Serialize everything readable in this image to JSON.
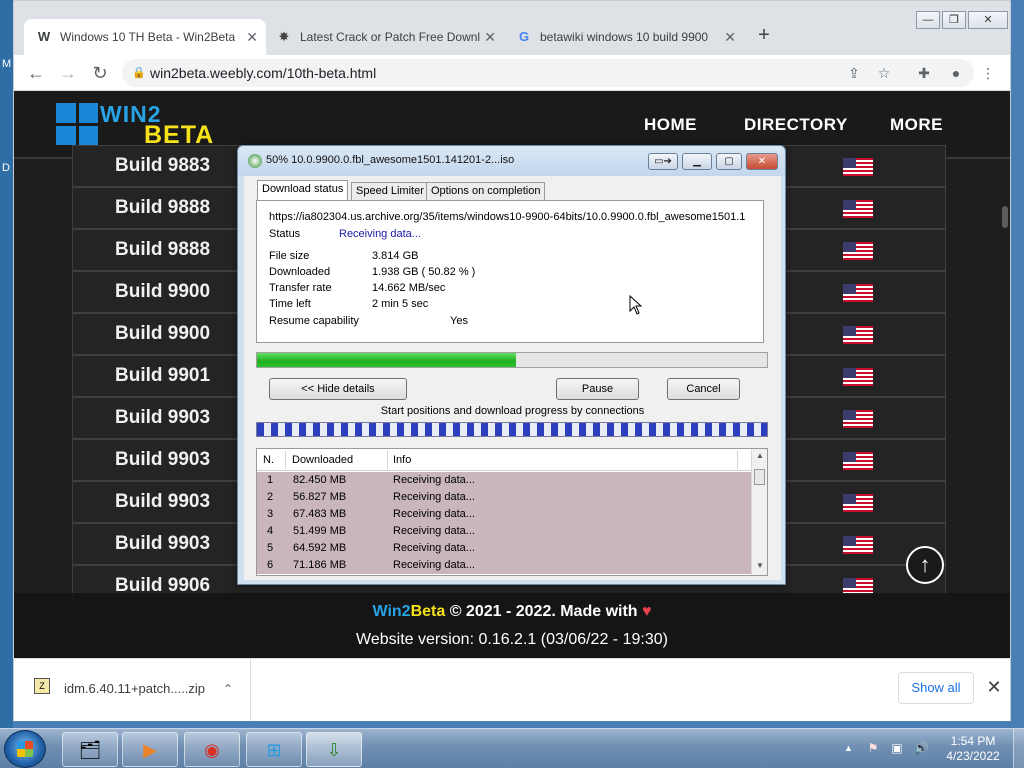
{
  "desktop": {
    "edge_labels": [
      "M",
      "D"
    ]
  },
  "browser": {
    "tabs": [
      {
        "title": "Windows 10 TH Beta - Win2Beta",
        "icon": "weebly-w-icon",
        "glyph": "W",
        "active": true
      },
      {
        "title": "Latest Crack or Patch Free Downl",
        "icon": "crack-site-icon",
        "glyph": "✸",
        "active": false
      },
      {
        "title": "betawiki windows 10 build 9900",
        "icon": "google-icon",
        "glyph": "G",
        "active": false
      }
    ],
    "new_tab": "+",
    "window_buttons": {
      "minimize": "—",
      "maximize": "❐",
      "close": "✕"
    },
    "url": "win2beta.weebly.com/10th-beta.html"
  },
  "site": {
    "logo": {
      "part1": "WIN2",
      "part2": "BETA"
    },
    "nav": [
      "HOME",
      "DIRECTORY",
      "MORE"
    ],
    "builds": [
      "Build 9883",
      "Build 9888",
      "Build 9888",
      "Build 9900",
      "Build 9900",
      "Build 9901",
      "Build 9903",
      "Build 9903",
      "Build 9903",
      "Build 9903",
      "Build 9906"
    ],
    "footer": {
      "brand_a": "Win2",
      "brand_b": "Beta",
      "copyright": " © 2021 - 2022. Made with ",
      "heart": "♥",
      "version": "Website version: 0.16.2.1 (03/06/22 - 19:30)"
    },
    "scroll_top": "↑"
  },
  "downloads_shelf": {
    "file_name": "idm.6.40.11+patch.....zip",
    "show_all": "Show all",
    "close": "✕"
  },
  "idm_dialog": {
    "title": "50% 10.0.9900.0.fbl_awesome1501.141201-2...iso",
    "tabs": [
      "Download status",
      "Speed Limiter",
      "Options on completion"
    ],
    "url": "https://ia802304.us.archive.org/35/items/windows10-9900-64bits/10.0.9900.0.fbl_awesome1501.1",
    "status_label": "Status",
    "status_value": "Receiving data...",
    "fields": [
      {
        "label": "File size",
        "value": "3.814  GB"
      },
      {
        "label": "Downloaded",
        "value": "1.938  GB  ( 50.82 % )"
      },
      {
        "label": "Transfer rate",
        "value": "14.662  MB/sec"
      },
      {
        "label": "Time left",
        "value": "2 min 5 sec"
      },
      {
        "label": "Resume capability",
        "value": "Yes"
      }
    ],
    "progress_percent": 50.82,
    "buttons": {
      "hide_details": "<< Hide details",
      "pause": "Pause",
      "cancel": "Cancel"
    },
    "connections_caption": "Start positions and download progress by connections",
    "table_headers": [
      "N.",
      "Downloaded",
      "Info"
    ],
    "connections": [
      {
        "n": "1",
        "downloaded": "82.450  MB",
        "info": "Receiving data..."
      },
      {
        "n": "2",
        "downloaded": "56.827  MB",
        "info": "Receiving data..."
      },
      {
        "n": "3",
        "downloaded": "67.483  MB",
        "info": "Receiving data..."
      },
      {
        "n": "4",
        "downloaded": "51.499  MB",
        "info": "Receiving data..."
      },
      {
        "n": "5",
        "downloaded": "64.592  MB",
        "info": "Receiving data..."
      },
      {
        "n": "6",
        "downloaded": "71.186  MB",
        "info": "Receiving data..."
      }
    ]
  },
  "taskbar": {
    "apps": [
      {
        "name": "explorer",
        "glyph": "🗂"
      },
      {
        "name": "media-player",
        "glyph": "▶"
      },
      {
        "name": "chrome",
        "glyph": "◉"
      },
      {
        "name": "windows-update",
        "glyph": "⊞"
      },
      {
        "name": "internet-download-manager",
        "glyph": "⇩"
      }
    ],
    "time": "1:54 PM",
    "date": "4/23/2022"
  }
}
